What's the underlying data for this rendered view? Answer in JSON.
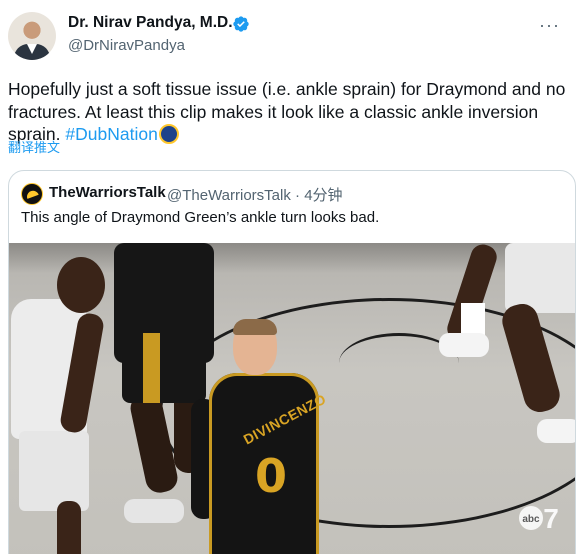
{
  "tweet": {
    "display_name": "Dr. Nirav Pandya, M.D.",
    "handle": "@DrNiravPandya",
    "text": "Hopefully just a soft tissue issue (i.e. ankle sprain) for Draymond and no fractures. At least this clip makes it look like a classic ankle inversion sprain.",
    "hashtag": "#DubNation",
    "translate_label": "翻译推文",
    "icons": {
      "verified": "verified-badge-icon",
      "more": "more-options-icon",
      "hashtag_emoji": "warriors-logo-icon"
    },
    "colors": {
      "link": "#1d9bf0",
      "secondary": "#536471",
      "primary_text": "#0f1419"
    }
  },
  "quote": {
    "display_name": "TheWarriorsTalk",
    "handle": "@TheWarriorsTalk",
    "separator": "·",
    "time": "4分钟",
    "text": "This angle of Draymond Green’s ankle turn looks bad.",
    "media": {
      "jersey_name": "DIVINCENZO",
      "jersey_number": "0",
      "watermark": "abc 7"
    }
  }
}
